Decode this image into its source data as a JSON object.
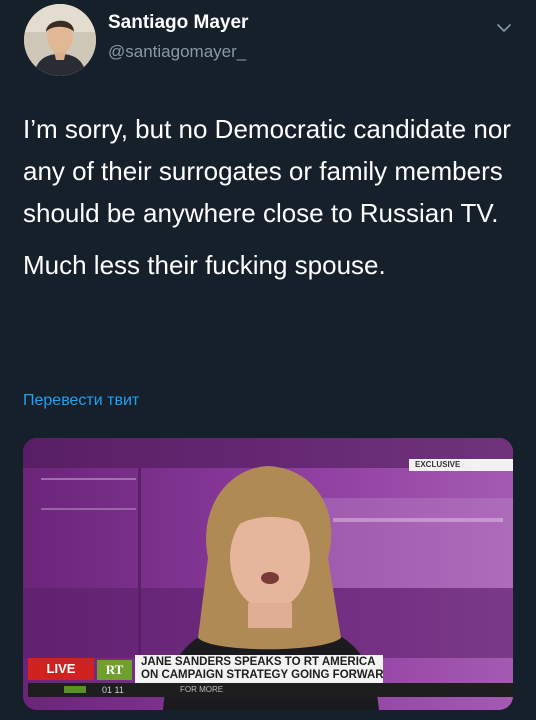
{
  "tweet": {
    "author_name": "Santiago Mayer",
    "author_handle": "@santiagomayer_",
    "paragraphs": [
      "I’m sorry, but no Democratic candidate nor any of their surrogates or family members should be anywhere close to Russian TV.",
      "Much less their fucking spouse."
    ],
    "translate_label": "Перевести твит"
  },
  "video": {
    "exclusive_label": "EXCLUSIVE",
    "live_label": "LIVE",
    "channel_logo": "RT",
    "headline_line1": "JANE SANDERS SPEAKS TO RT AMERICA",
    "headline_line2": "ON CAMPAIGN STRATEGY GOING FORWARD",
    "clock": "01 11",
    "ticker_text": "FOR MORE"
  },
  "icons": {
    "chevron": "chevron-down-icon"
  },
  "colors": {
    "background": "#15202b",
    "text_primary": "#ffffff",
    "text_secondary": "#8899a6",
    "link": "#1da1f2",
    "live_red": "#d0231f",
    "rt_green": "#6fa02d"
  }
}
